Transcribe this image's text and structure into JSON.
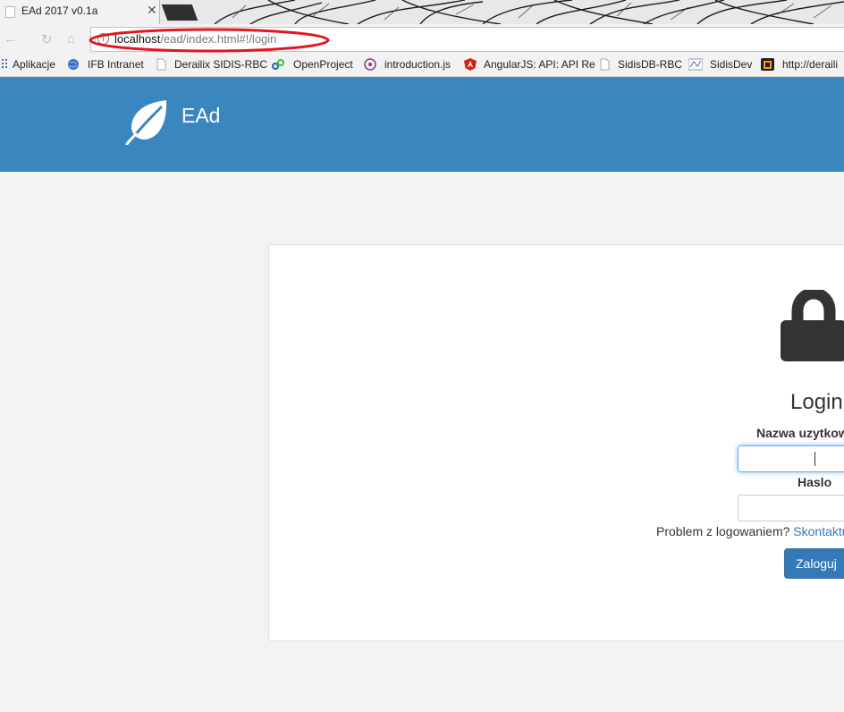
{
  "browser": {
    "tab": {
      "title": "EAd 2017 v0.1a",
      "close": "✕"
    },
    "address_bar": {
      "host": "localhost",
      "path": "/ead/index.html#!/login"
    },
    "bookmarks": [
      {
        "label": "Aplikacje",
        "icon": "apps-grid-icon"
      },
      {
        "label": "IFB Intranet",
        "icon": "globe-icon"
      },
      {
        "label": "Derailix SIDIS-RBC",
        "icon": "page-icon"
      },
      {
        "label": "OpenProject",
        "icon": "openproject-icon"
      },
      {
        "label": "introduction.js",
        "icon": "introjs-icon"
      },
      {
        "label": "AngularJS: API: API Re",
        "icon": "angular-icon"
      },
      {
        "label": "SidisDB-RBC",
        "icon": "page-icon"
      },
      {
        "label": "SidisDev",
        "icon": "sidisdev-icon"
      },
      {
        "label": "http://deraili",
        "icon": "rss-icon"
      }
    ],
    "colors": {
      "annotation": "#e3161f"
    }
  },
  "app": {
    "brand": "EAd",
    "colors": {
      "header": "#3a86bf",
      "primary": "#337ab7",
      "link": "#337ab7"
    }
  },
  "login": {
    "title": "Login",
    "username_label": "Nazwa uzytkow",
    "password_label": "Haslo",
    "problem_text": "Problem z logowaniem? ",
    "contact_link": "Skontaktu",
    "submit_label": "Zaloguj"
  }
}
